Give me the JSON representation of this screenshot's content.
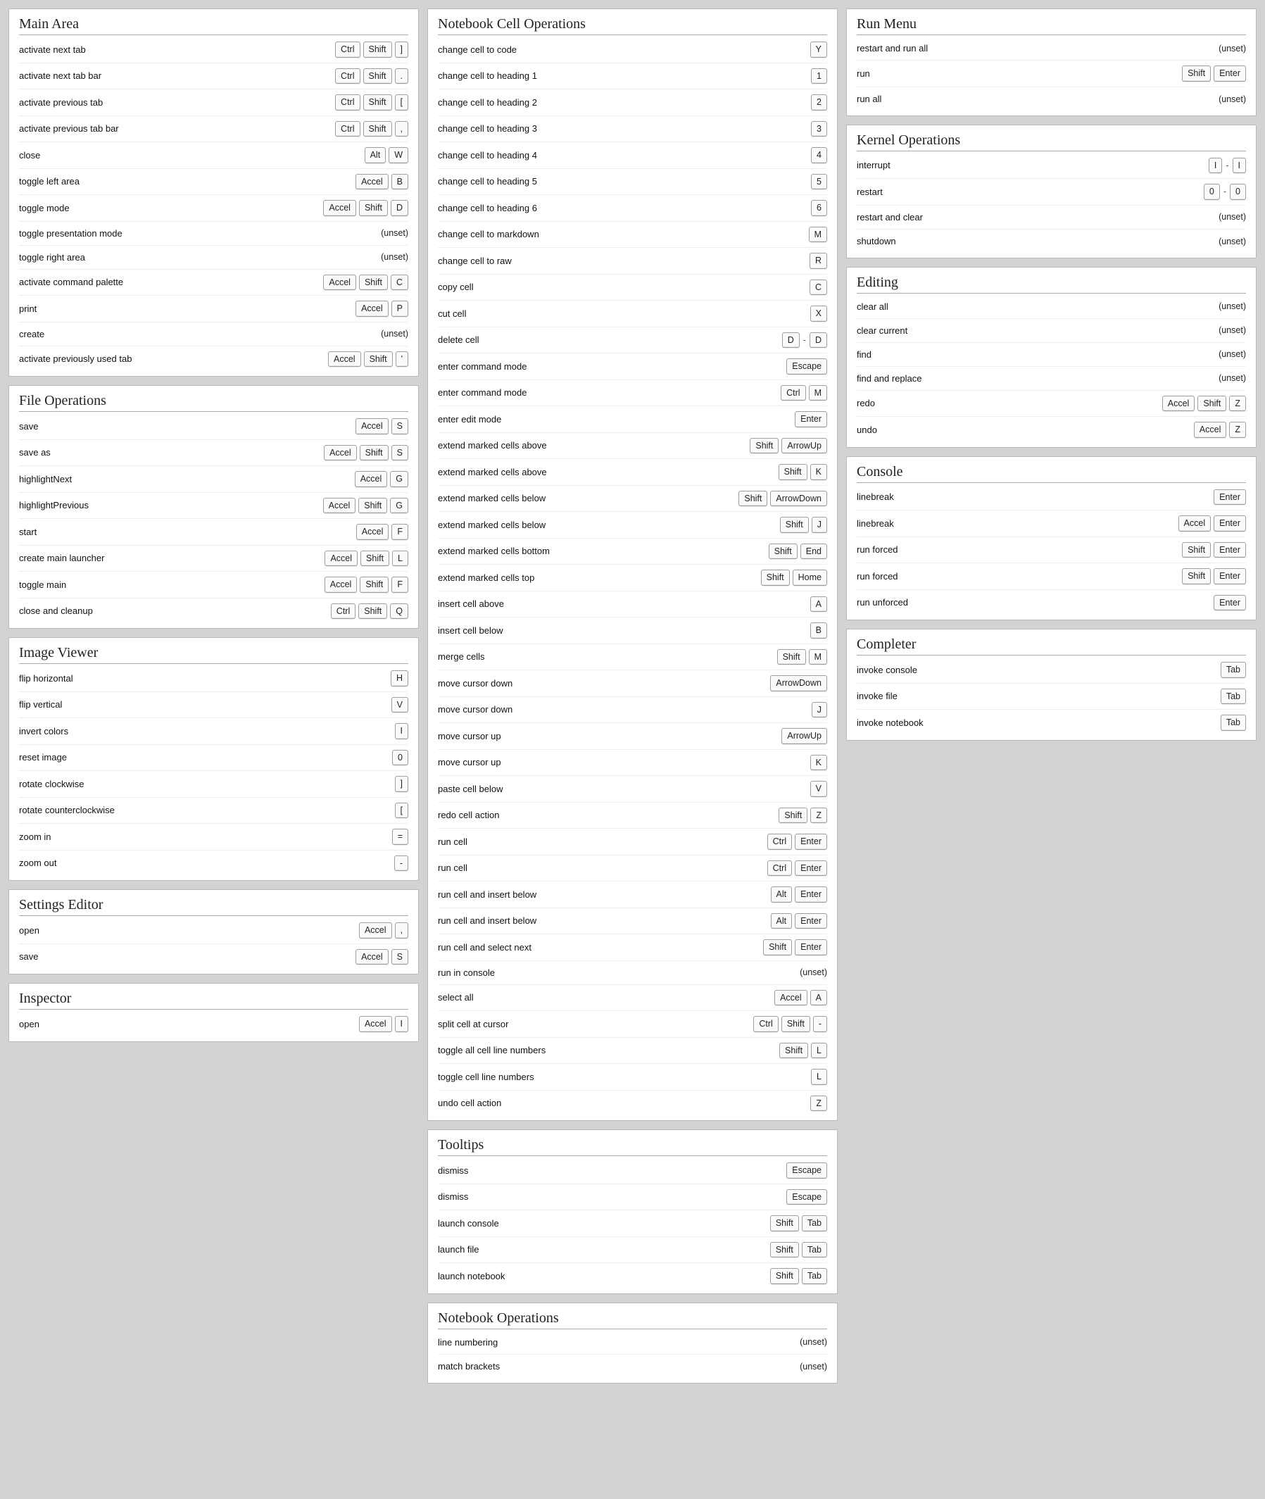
{
  "unset_label": "(unset)",
  "cards": [
    {
      "title": "Main Area",
      "items": [
        {
          "label": "activate next tab",
          "keys": [
            [
              "Ctrl",
              "Shift",
              "]"
            ]
          ]
        },
        {
          "label": "activate next tab bar",
          "keys": [
            [
              "Ctrl",
              "Shift",
              "."
            ]
          ]
        },
        {
          "label": "activate previous tab",
          "keys": [
            [
              "Ctrl",
              "Shift",
              "["
            ]
          ]
        },
        {
          "label": "activate previous tab bar",
          "keys": [
            [
              "Ctrl",
              "Shift",
              ","
            ]
          ]
        },
        {
          "label": "close",
          "keys": [
            [
              "Alt",
              "W"
            ]
          ]
        },
        {
          "label": "toggle left area",
          "keys": [
            [
              "Accel",
              "B"
            ]
          ]
        },
        {
          "label": "toggle mode",
          "keys": [
            [
              "Accel",
              "Shift",
              "D"
            ]
          ]
        },
        {
          "label": "toggle presentation mode",
          "keys": null
        },
        {
          "label": "toggle right area",
          "keys": null
        },
        {
          "label": "activate command palette",
          "keys": [
            [
              "Accel",
              "Shift",
              "C"
            ]
          ]
        },
        {
          "label": "print",
          "keys": [
            [
              "Accel",
              "P"
            ]
          ]
        },
        {
          "label": "create",
          "keys": null
        },
        {
          "label": "activate previously used tab",
          "keys": [
            [
              "Accel",
              "Shift",
              "'"
            ]
          ]
        }
      ]
    },
    {
      "title": "File Operations",
      "items": [
        {
          "label": "save",
          "keys": [
            [
              "Accel",
              "S"
            ]
          ]
        },
        {
          "label": "save as",
          "keys": [
            [
              "Accel",
              "Shift",
              "S"
            ]
          ]
        },
        {
          "label": "highlightNext",
          "keys": [
            [
              "Accel",
              "G"
            ]
          ]
        },
        {
          "label": "highlightPrevious",
          "keys": [
            [
              "Accel",
              "Shift",
              "G"
            ]
          ]
        },
        {
          "label": "start",
          "keys": [
            [
              "Accel",
              "F"
            ]
          ]
        },
        {
          "label": "create main launcher",
          "keys": [
            [
              "Accel",
              "Shift",
              "L"
            ]
          ]
        },
        {
          "label": "toggle main",
          "keys": [
            [
              "Accel",
              "Shift",
              "F"
            ]
          ]
        },
        {
          "label": "close and cleanup",
          "keys": [
            [
              "Ctrl",
              "Shift",
              "Q"
            ]
          ]
        }
      ]
    },
    {
      "title": "Image Viewer",
      "items": [
        {
          "label": "flip horizontal",
          "keys": [
            [
              "H"
            ]
          ]
        },
        {
          "label": "flip vertical",
          "keys": [
            [
              "V"
            ]
          ]
        },
        {
          "label": "invert colors",
          "keys": [
            [
              "I"
            ]
          ]
        },
        {
          "label": "reset image",
          "keys": [
            [
              "0"
            ]
          ]
        },
        {
          "label": "rotate clockwise",
          "keys": [
            [
              "]"
            ]
          ]
        },
        {
          "label": "rotate counterclockwise",
          "keys": [
            [
              "["
            ]
          ]
        },
        {
          "label": "zoom in",
          "keys": [
            [
              "="
            ]
          ]
        },
        {
          "label": "zoom out",
          "keys": [
            [
              "-"
            ]
          ]
        }
      ]
    },
    {
      "title": "Settings Editor",
      "items": [
        {
          "label": "open",
          "keys": [
            [
              "Accel",
              ","
            ]
          ]
        },
        {
          "label": "save",
          "keys": [
            [
              "Accel",
              "S"
            ]
          ]
        }
      ]
    },
    {
      "title": "Inspector",
      "items": [
        {
          "label": "open",
          "keys": [
            [
              "Accel",
              "I"
            ]
          ]
        }
      ]
    },
    {
      "title": "Notebook Cell Operations",
      "items": [
        {
          "label": "change cell to code",
          "keys": [
            [
              "Y"
            ]
          ]
        },
        {
          "label": "change cell to heading 1",
          "keys": [
            [
              "1"
            ]
          ]
        },
        {
          "label": "change cell to heading 2",
          "keys": [
            [
              "2"
            ]
          ]
        },
        {
          "label": "change cell to heading 3",
          "keys": [
            [
              "3"
            ]
          ]
        },
        {
          "label": "change cell to heading 4",
          "keys": [
            [
              "4"
            ]
          ]
        },
        {
          "label": "change cell to heading 5",
          "keys": [
            [
              "5"
            ]
          ]
        },
        {
          "label": "change cell to heading 6",
          "keys": [
            [
              "6"
            ]
          ]
        },
        {
          "label": "change cell to markdown",
          "keys": [
            [
              "M"
            ]
          ]
        },
        {
          "label": "change cell to raw",
          "keys": [
            [
              "R"
            ]
          ]
        },
        {
          "label": "copy cell",
          "keys": [
            [
              "C"
            ]
          ]
        },
        {
          "label": "cut cell",
          "keys": [
            [
              "X"
            ]
          ]
        },
        {
          "label": "delete cell",
          "keys": [
            [
              "D"
            ],
            [
              "D"
            ]
          ]
        },
        {
          "label": "enter command mode",
          "keys": [
            [
              "Escape"
            ]
          ]
        },
        {
          "label": "enter command mode",
          "keys": [
            [
              "Ctrl",
              "M"
            ]
          ]
        },
        {
          "label": "enter edit mode",
          "keys": [
            [
              "Enter"
            ]
          ]
        },
        {
          "label": "extend marked cells above",
          "keys": [
            [
              "Shift",
              "ArrowUp"
            ]
          ]
        },
        {
          "label": "extend marked cells above",
          "keys": [
            [
              "Shift",
              "K"
            ]
          ]
        },
        {
          "label": "extend marked cells below",
          "keys": [
            [
              "Shift",
              "ArrowDown"
            ]
          ]
        },
        {
          "label": "extend marked cells below",
          "keys": [
            [
              "Shift",
              "J"
            ]
          ]
        },
        {
          "label": "extend marked cells bottom",
          "keys": [
            [
              "Shift",
              "End"
            ]
          ]
        },
        {
          "label": "extend marked cells top",
          "keys": [
            [
              "Shift",
              "Home"
            ]
          ]
        },
        {
          "label": "insert cell above",
          "keys": [
            [
              "A"
            ]
          ]
        },
        {
          "label": "insert cell below",
          "keys": [
            [
              "B"
            ]
          ]
        },
        {
          "label": "merge cells",
          "keys": [
            [
              "Shift",
              "M"
            ]
          ]
        },
        {
          "label": "move cursor down",
          "keys": [
            [
              "ArrowDown"
            ]
          ]
        },
        {
          "label": "move cursor down",
          "keys": [
            [
              "J"
            ]
          ]
        },
        {
          "label": "move cursor up",
          "keys": [
            [
              "ArrowUp"
            ]
          ]
        },
        {
          "label": "move cursor up",
          "keys": [
            [
              "K"
            ]
          ]
        },
        {
          "label": "paste cell below",
          "keys": [
            [
              "V"
            ]
          ]
        },
        {
          "label": "redo cell action",
          "keys": [
            [
              "Shift",
              "Z"
            ]
          ]
        },
        {
          "label": "run cell",
          "keys": [
            [
              "Ctrl",
              "Enter"
            ]
          ]
        },
        {
          "label": "run cell",
          "keys": [
            [
              "Ctrl",
              "Enter"
            ]
          ]
        },
        {
          "label": "run cell and insert below",
          "keys": [
            [
              "Alt",
              "Enter"
            ]
          ]
        },
        {
          "label": "run cell and insert below",
          "keys": [
            [
              "Alt",
              "Enter"
            ]
          ]
        },
        {
          "label": "run cell and select next",
          "keys": [
            [
              "Shift",
              "Enter"
            ]
          ]
        },
        {
          "label": "run in console",
          "keys": null
        },
        {
          "label": "select all",
          "keys": [
            [
              "Accel",
              "A"
            ]
          ]
        },
        {
          "label": "split cell at cursor",
          "keys": [
            [
              "Ctrl",
              "Shift",
              "-"
            ]
          ]
        },
        {
          "label": "toggle all cell line numbers",
          "keys": [
            [
              "Shift",
              "L"
            ]
          ]
        },
        {
          "label": "toggle cell line numbers",
          "keys": [
            [
              "L"
            ]
          ]
        },
        {
          "label": "undo cell action",
          "keys": [
            [
              "Z"
            ]
          ]
        }
      ]
    },
    {
      "title": "Tooltips",
      "items": [
        {
          "label": "dismiss",
          "keys": [
            [
              "Escape"
            ]
          ]
        },
        {
          "label": "dismiss",
          "keys": [
            [
              "Escape"
            ]
          ]
        },
        {
          "label": "launch console",
          "keys": [
            [
              "Shift",
              "Tab"
            ]
          ]
        },
        {
          "label": "launch file",
          "keys": [
            [
              "Shift",
              "Tab"
            ]
          ]
        },
        {
          "label": "launch notebook",
          "keys": [
            [
              "Shift",
              "Tab"
            ]
          ]
        }
      ]
    },
    {
      "title": "Notebook Operations",
      "items": [
        {
          "label": "line numbering",
          "keys": null
        },
        {
          "label": "match brackets",
          "keys": null
        }
      ]
    },
    {
      "title": "Run Menu",
      "items": [
        {
          "label": "restart and run all",
          "keys": null
        },
        {
          "label": "run",
          "keys": [
            [
              "Shift",
              "Enter"
            ]
          ]
        },
        {
          "label": "run all",
          "keys": null
        }
      ]
    },
    {
      "title": "Kernel Operations",
      "items": [
        {
          "label": "interrupt",
          "keys": [
            [
              "I"
            ],
            [
              "I"
            ]
          ]
        },
        {
          "label": "restart",
          "keys": [
            [
              "0"
            ],
            [
              "0"
            ]
          ]
        },
        {
          "label": "restart and clear",
          "keys": null
        },
        {
          "label": "shutdown",
          "keys": null
        }
      ]
    },
    {
      "title": "Editing",
      "items": [
        {
          "label": "clear all",
          "keys": null
        },
        {
          "label": "clear current",
          "keys": null
        },
        {
          "label": "find",
          "keys": null
        },
        {
          "label": "find and replace",
          "keys": null
        },
        {
          "label": "redo",
          "keys": [
            [
              "Accel",
              "Shift",
              "Z"
            ]
          ]
        },
        {
          "label": "undo",
          "keys": [
            [
              "Accel",
              "Z"
            ]
          ]
        }
      ]
    },
    {
      "title": "Console",
      "items": [
        {
          "label": "linebreak",
          "keys": [
            [
              "Enter"
            ]
          ]
        },
        {
          "label": "linebreak",
          "keys": [
            [
              "Accel",
              "Enter"
            ]
          ]
        },
        {
          "label": "run forced",
          "keys": [
            [
              "Shift",
              "Enter"
            ]
          ]
        },
        {
          "label": "run forced",
          "keys": [
            [
              "Shift",
              "Enter"
            ]
          ]
        },
        {
          "label": "run unforced",
          "keys": [
            [
              "Enter"
            ]
          ]
        }
      ]
    },
    {
      "title": "Completer",
      "items": [
        {
          "label": "invoke console",
          "keys": [
            [
              "Tab"
            ]
          ]
        },
        {
          "label": "invoke file",
          "keys": [
            [
              "Tab"
            ]
          ]
        },
        {
          "label": "invoke notebook",
          "keys": [
            [
              "Tab"
            ]
          ]
        }
      ]
    }
  ]
}
